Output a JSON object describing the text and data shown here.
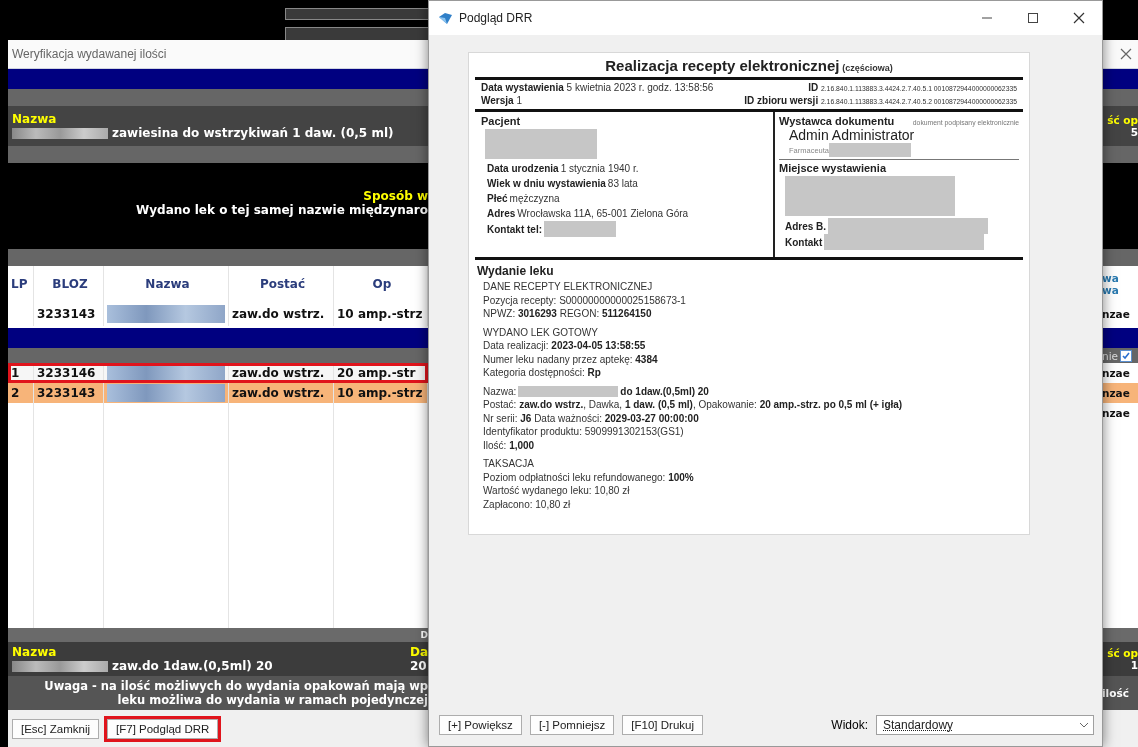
{
  "verification_window": {
    "title": "Weryfikacja wydawanej ilości",
    "prescribed": {
      "label": "Nazwa",
      "value": "zawiesina do wstrzykiwań 1 daw. (0,5 ml)",
      "column_2_label": "ść op",
      "column_2_value": "5"
    },
    "method": {
      "label": "Sposób w",
      "value": "Wydano lek o tej samej nazwie międzynaro"
    },
    "table": {
      "columns": [
        "LP",
        "BLOZ",
        "Nazwa",
        "Postać",
        "Op"
      ],
      "column_right": [
        "wa",
        "wa"
      ],
      "prescribed_row": {
        "bloz": "3233143",
        "form": "zaw.do wstrz.",
        "package": "10 amp.-strz",
        "column_right": "nzae"
      },
      "filter": {
        "label": "nie",
        "checked": true
      },
      "rows": [
        {
          "lp": "1",
          "bloz": "3233146",
          "form": "zaw.do wstrz.",
          "package": "20 amp.-str",
          "column_right": "nzae",
          "selected": true,
          "highlighted": false
        },
        {
          "lp": "2",
          "bloz": "3233143",
          "form": "zaw.do wstrz.",
          "package": "10 amp.-strz",
          "column_right": "nzae",
          "selected": false,
          "highlighted": true
        },
        {
          "column_right": "nzae",
          "selected": false,
          "highlighted": false
        }
      ]
    },
    "divider_label": "D",
    "dispensed": {
      "label": "Nazwa",
      "value": "zaw.do 1daw.(0,5ml) 20",
      "column_2_label": "Da",
      "column_2_value": "20",
      "column_3_label": "ść op",
      "column_3_value": "1"
    },
    "warning": {
      "lines": [
        "Uwaga - na ilość możliwych do wydania opakowań mają wp",
        "leku możliwa do wydania w ramach pojedynczej"
      ],
      "right": "ilość"
    },
    "buttons": [
      {
        "label": "[Esc] Zamknij",
        "marked": false
      },
      {
        "label": "[F7] Podgląd DRR",
        "marked": true
      }
    ]
  },
  "preview_dialog": {
    "title": "Podgląd DRR",
    "document": {
      "title": "Realizacja recepty elektronicznej",
      "title_note": "(częściowa)",
      "header_fields": [
        {
          "label": "Data wystawienia",
          "value": "5 kwietnia 2023 r. godz. 13:58:56"
        },
        {
          "label": "ID",
          "value": "2.16.840.1.113883.3.4424.2.7.40.5.1 0010872944000000062335"
        },
        {
          "label": "Wersja",
          "value": "1"
        },
        {
          "label": "ID zbioru wersji",
          "value": "2.16.840.1.113883.3.4424.2.7.40.5.2 0010872944000000062335"
        }
      ],
      "patient": {
        "heading": "Pacjent",
        "fields": [
          {
            "label": "Data urodzenia",
            "value": "1 stycznia 1940 r."
          },
          {
            "label": "Wiek w dniu wystawienia",
            "value": "83 lata"
          },
          {
            "label": "Płeć",
            "value": "mężczyzna"
          },
          {
            "label": "Adres",
            "value": "Wrocławska 11A, 65-001 Zielona Góra"
          },
          {
            "label": "Kontakt tel:"
          }
        ]
      },
      "issuer": {
        "heading": "Wystawca dokumentu",
        "note": "dokument podpisany elektronicznie",
        "name": "Admin Administrator",
        "role": "Farmaceuta"
      },
      "place": {
        "heading": "Miejsce wystawienia",
        "fields": [
          {
            "label": "Adres B."
          },
          {
            "label": "Kontakt"
          }
        ]
      },
      "dispensing": {
        "heading": "Wydanie leku",
        "groups": [
          [
            {
              "kind": "text",
              "text": "DANE RECEPTY ELEKTRONICZNEJ"
            },
            {
              "kind": "text",
              "text": "Pozycja recepty: S00000000000025158673-1"
            },
            {
              "kind": "text",
              "text": "NPWZ: **3016293** REGON: **511264150**"
            }
          ],
          [
            {
              "kind": "text",
              "text": "WYDANO LEK GOTOWY"
            },
            {
              "kind": "text",
              "text": "Data realizacji: **2023-04-05 13:58:55**"
            },
            {
              "kind": "text",
              "text": "Numer leku nadany przez aptekę: **4384**"
            },
            {
              "kind": "text",
              "text": "Kategoria dostępności: **Rp**"
            }
          ],
          [
            {
              "kind": "redacted",
              "before": "Nazwa:",
              "after": "do 1daw.(0,5ml) 20"
            },
            {
              "kind": "text",
              "text": "Postać: **zaw.do wstrz.**, Dawka, **1 daw. (0,5 ml)**, Opakowanie: **20 amp.-strz. po 0,5 ml (+ igła)**"
            },
            {
              "kind": "text",
              "text": "Nr serii: **J6** Data ważności: **2029-03-27 00:00:00**"
            },
            {
              "kind": "text",
              "text": "Identyfikator produktu: 5909991302153(GS1)"
            },
            {
              "kind": "text",
              "text": "Ilość: **1,000**"
            }
          ],
          [
            {
              "kind": "text",
              "text": "TAKSACJA"
            },
            {
              "kind": "text",
              "text": "Poziom odpłatności leku refundowanego: **100%**"
            },
            {
              "kind": "text",
              "text": "Wartość wydanego leku: 10,80 zł"
            },
            {
              "kind": "text",
              "text": "Zapłacono: 10,80 zł"
            }
          ]
        ]
      }
    },
    "toolbar": {
      "buttons": [
        "[+] Powiększ",
        "[-] Pomniejsz",
        "[F10] Drukuj"
      ],
      "view_label": "Widok:",
      "view_value": "Standardowy"
    }
  }
}
